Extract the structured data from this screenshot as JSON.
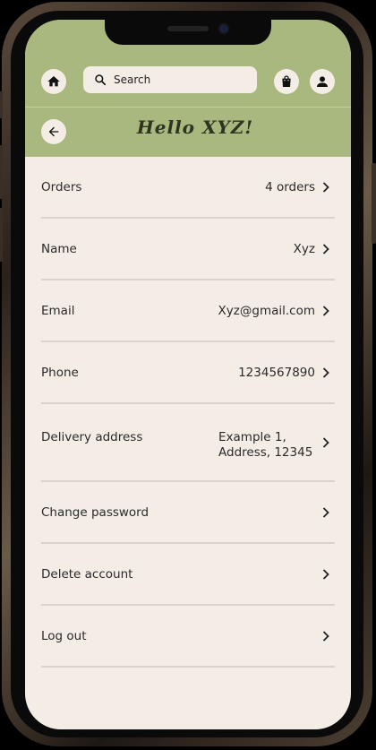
{
  "header": {
    "search_placeholder": "Search",
    "greeting": "Hello XYZ!"
  },
  "icons": {
    "home": "home-icon",
    "search": "search-icon",
    "cart": "shopping-bag-icon",
    "account": "account-icon",
    "back": "back-arrow-icon",
    "chevron": "chevron-right-icon"
  },
  "colors": {
    "header_bg": "#a8b87f",
    "page_bg": "#f4ede6",
    "divider": "#d9d3cc"
  },
  "rows": [
    {
      "label": "Orders",
      "value": "4 orders"
    },
    {
      "label": "Name",
      "value": "Xyz"
    },
    {
      "label": "Email",
      "value": "Xyz@gmail.com"
    },
    {
      "label": "Phone",
      "value": "1234567890"
    },
    {
      "label": "Delivery address",
      "value": "Example 1, Address, 12345"
    },
    {
      "label": "Change password",
      "value": ""
    },
    {
      "label": "Delete account",
      "value": ""
    },
    {
      "label": "Log out",
      "value": ""
    }
  ]
}
